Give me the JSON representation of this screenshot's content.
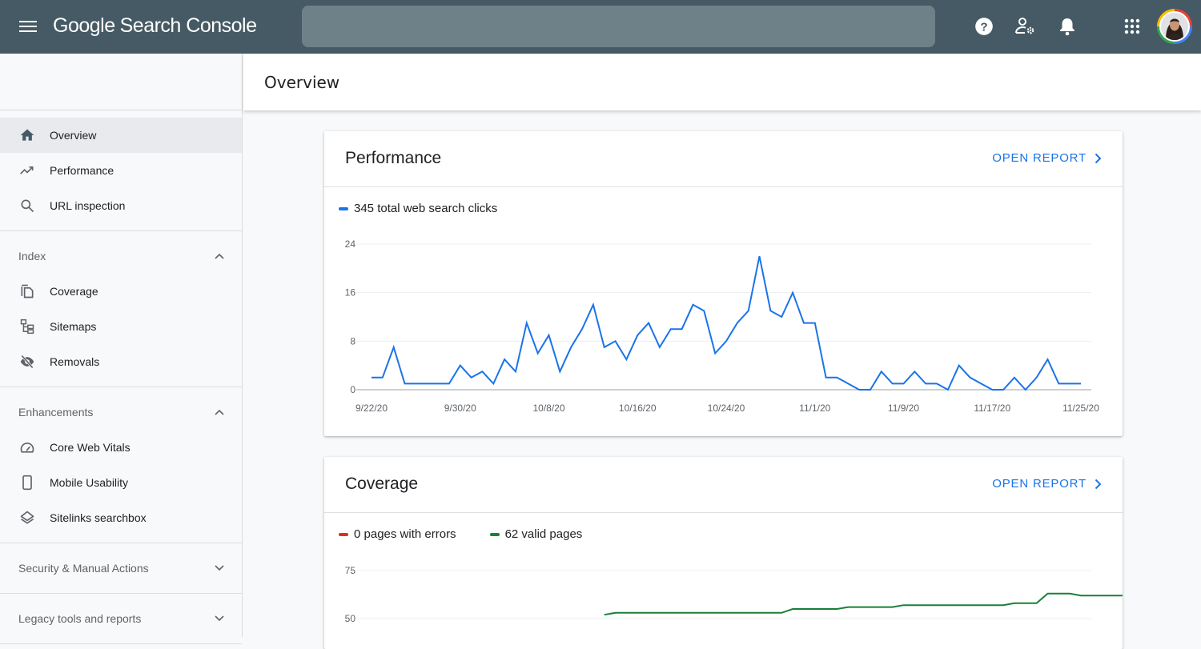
{
  "app": {
    "title_google": "Google",
    "title_product": "Search Console",
    "search_placeholder": ""
  },
  "topbar_icons": [
    {
      "name": "help-icon"
    },
    {
      "name": "admin-settings-icon"
    },
    {
      "name": "notifications-icon"
    },
    {
      "name": "apps-grid-icon"
    },
    {
      "name": "account-avatar"
    }
  ],
  "page": {
    "title": "Overview"
  },
  "sidebar": {
    "top_items": [
      {
        "label": "Overview",
        "icon": "home-icon",
        "active": true
      },
      {
        "label": "Performance",
        "icon": "trending-up-icon"
      },
      {
        "label": "URL inspection",
        "icon": "search-icon"
      }
    ],
    "sections": [
      {
        "label": "Index",
        "expanded": true,
        "items": [
          {
            "label": "Coverage",
            "icon": "coverage-icon"
          },
          {
            "label": "Sitemaps",
            "icon": "sitemap-icon"
          },
          {
            "label": "Removals",
            "icon": "visibility-off-icon"
          }
        ]
      },
      {
        "label": "Enhancements",
        "expanded": true,
        "items": [
          {
            "label": "Core Web Vitals",
            "icon": "speedometer-icon"
          },
          {
            "label": "Mobile Usability",
            "icon": "smartphone-icon"
          },
          {
            "label": "Sitelinks searchbox",
            "icon": "layers-icon"
          }
        ]
      },
      {
        "label": "Security & Manual Actions",
        "expanded": false,
        "items": []
      },
      {
        "label": "Legacy tools and reports",
        "expanded": false,
        "items": []
      }
    ]
  },
  "cards": {
    "performance": {
      "title": "Performance",
      "open_report": "OPEN REPORT",
      "legend": [
        {
          "label": "345 total web search clicks",
          "color": "#1a73e8"
        }
      ]
    },
    "coverage": {
      "title": "Coverage",
      "open_report": "OPEN REPORT",
      "legend": [
        {
          "label": "0 pages with errors",
          "color": "#d93025"
        },
        {
          "label": "62 valid pages",
          "color": "#188038"
        }
      ]
    }
  },
  "chart_data": [
    {
      "type": "line",
      "title": "Performance",
      "series": [
        {
          "name": "345 total web search clicks",
          "color": "#1a73e8",
          "start_date": "9/22/20",
          "values": [
            2,
            2,
            7,
            1,
            1,
            1,
            1,
            1,
            4,
            2,
            3,
            1,
            5,
            3,
            11,
            6,
            9,
            3,
            7,
            10,
            14,
            7,
            8,
            5,
            9,
            11,
            7,
            10,
            10,
            14,
            13,
            6,
            8,
            11,
            13,
            22,
            13,
            12,
            16,
            11,
            11,
            2,
            2,
            1,
            0,
            0,
            3,
            1,
            1,
            3,
            1,
            1,
            0,
            4,
            2,
            1,
            0,
            0,
            2,
            0,
            2,
            5,
            1,
            1,
            1
          ]
        }
      ],
      "x_tick_labels": [
        "9/22/20",
        "9/30/20",
        "10/8/20",
        "10/16/20",
        "10/24/20",
        "11/1/20",
        "11/9/20",
        "11/17/20",
        "11/25/20"
      ],
      "x_tick_every": 8,
      "y_ticks": [
        0,
        8,
        16,
        24
      ],
      "ylim": [
        0,
        24
      ],
      "grid": true,
      "xlabel": "",
      "ylabel": ""
    },
    {
      "type": "line",
      "title": "Coverage",
      "series": [
        {
          "name": "0 pages with errors",
          "color": "#d93025",
          "values": []
        },
        {
          "name": "62 valid pages",
          "color": "#188038",
          "start_index": 21,
          "values": [
            52,
            53,
            53,
            53,
            53,
            53,
            53,
            53,
            53,
            53,
            53,
            53,
            53,
            53,
            53,
            53,
            53,
            55,
            55,
            55,
            55,
            55,
            56,
            56,
            56,
            56,
            56,
            57,
            57,
            57,
            57,
            57,
            57,
            57,
            57,
            57,
            57,
            58,
            58,
            58,
            63,
            63,
            63,
            62,
            62,
            62,
            62,
            62,
            62,
            62,
            62,
            62,
            62,
            62
          ]
        }
      ],
      "x_points_total": 65,
      "y_ticks": [
        50,
        75
      ],
      "grid": true,
      "xlabel": "",
      "ylabel": ""
    }
  ]
}
